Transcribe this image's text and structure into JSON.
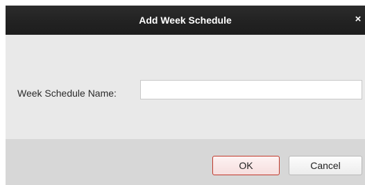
{
  "dialog": {
    "title": "Add Week Schedule",
    "close_glyph": "×",
    "close_icon": "close-icon"
  },
  "form": {
    "name_label": "Week Schedule Name:",
    "name_value": "",
    "name_placeholder": ""
  },
  "buttons": {
    "ok_label": "OK",
    "cancel_label": "Cancel"
  },
  "colors": {
    "titlebar": "#222222",
    "body": "#e9e9e9",
    "footer": "#d7d7d7",
    "ok_border": "#c0392b"
  }
}
